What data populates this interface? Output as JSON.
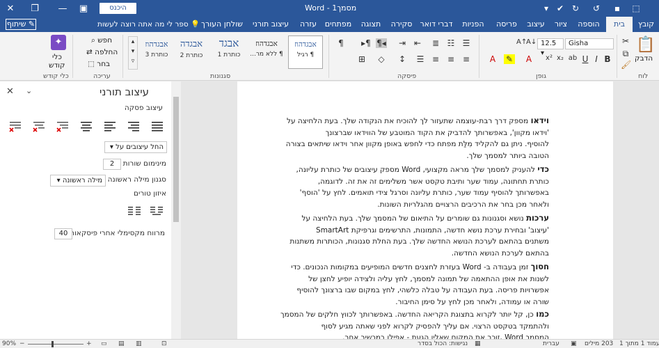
{
  "titlebar": {
    "doc_title": "מסמך1 - Word",
    "signin_label": "היכנס",
    "min_icon": "minimize-icon",
    "max_icon": "restore-icon",
    "close_icon": "close-icon"
  },
  "tabs": [
    "קובץ",
    "בית",
    "הוספה",
    "ציור",
    "עיצוב",
    "פריסה",
    "הפניות",
    "דברי דואר",
    "סקירה",
    "תצוגה",
    "מפתחים",
    "עזרה",
    "עיצוב תורני",
    "שולחן העורך"
  ],
  "tellme": "ספר לי מה אתה רוצה לעשות",
  "share_label": "שיתוף",
  "ribbon": {
    "clipboard": {
      "paste": "הדבק",
      "label": "לוח"
    },
    "font": {
      "name": "Gisha",
      "size": "12.5",
      "label": "גופן"
    },
    "paragraph": {
      "label": "פיסקה"
    },
    "styles": {
      "label": "סגנונות",
      "items": [
        {
          "sample": "אבגדהוז",
          "name": "¶ רגיל"
        },
        {
          "sample": "אבגדהוז",
          "name": "¶ ללא מר..."
        },
        {
          "sample": "אבגד",
          "name": "כותרת 1"
        },
        {
          "sample": "אבגדה",
          "name": "כותרת 2"
        },
        {
          "sample": "אבגדהוז",
          "name": "כותרת 3"
        }
      ]
    },
    "editing": {
      "find": "חפש",
      "replace": "החלפה",
      "select": "בחר",
      "label": "עריכה"
    },
    "holy": {
      "tools": "כלי",
      "holy": "קודש",
      "label": "כלי קודש"
    }
  },
  "pane": {
    "title": "עיצוב תורני",
    "section_paragraph": "עיצוב פסקה",
    "apply_styles": "החל עיצובים על",
    "min_lines_label": "מינימום שורות",
    "min_lines_value": "2",
    "first_word_label": "סגנון מילה ראשונה",
    "first_word_value": "מילה ראשונה",
    "columns_label": "איזון טורים",
    "max_spacing_label": "מרווח מקסימלי אחרי פיסקאות",
    "max_spacing_value": "40"
  },
  "document": {
    "paragraphs": [
      {
        "lead": "וידאו",
        "lines": [
          "מספק דרך רבת-עוצמה שתעזור לך להוכיח את הנקודה שלך. בעת הלחיצה על",
          "'וידאו מקוון', באפשרותך להדביק את הקוד המוטבע של הווידאו שברצונך",
          "להוסיף. ניתן גם להקליד מִלַּת מפתח כדי לחפש באופן מקוון אחר וידאו שיתאים בצורה",
          "הטובה ביותר למסמך שלך."
        ]
      },
      {
        "lead": "כדי",
        "lines": [
          "להעניק למסמך שלך מראה מקצועי, Word מספק עיצובים של כותרת עליונה,",
          "כותרת תחתונה, עמוד שער ותיבת טקסט אשר משלימים זה את זה. לדוגמה,",
          "באפשרותך להוסיף עמוד שער, כותרת עליונה וסרגל צידי תואמים. לחץ על 'הוסף'",
          "ולאחר מכן בחר את הרכיבים הרצויים מהגלריות השונות."
        ]
      },
      {
        "lead": "ערכות",
        "lines": [
          "נושא וסגנונות גם שומרים על התיאום של המסמך שלך. בעת הלחיצה על",
          "'עיצוב' ובחירת ערכת נושא חדשה, התמונות, התרשימים וגרפיקת SmartArt",
          "משתנים בהתאם לערכת הנושא החדשה שלך. בעת החלת סגנונות, הכותרות משתנות",
          "בהתאם לערכת הנושא החדשה."
        ]
      },
      {
        "lead": "חסוך",
        "lines": [
          "זמן בעבודה ב- Word בעזרת לחצנים חדשים המופיעים במקומות הנכונים. כדי",
          "לשנות את אופן ההתאמה של תמונה למסמך, לחץ עליה ולצידה יופיע לחצן של",
          "אפשרויות פריסה. בעת העבודה על טבלה כלשהי, לחץ במקום שבו ברצונך להוסיף",
          "שורה או עמודה, ולאחר מכן לחץ על סימן החיבור."
        ]
      },
      {
        "lead": "כמו",
        "lines": [
          "כן, קל יותר לקרוא בתצוגת הקריאה החדשה. באפשרותך לכווץ חלקים של המסמך",
          "ולהתמקד בטקסט הרצוי. אם עליך להפסיק לקרוא לפני שאתה מגיע לסוף",
          "המסמך Word ,זוכר את המקום שאליו הגעת - אפילו במכשיר אחר."
        ]
      }
    ]
  },
  "status": {
    "page": "עמוד 1 מתוך 1",
    "words": "203 מילים",
    "language": "עברית",
    "accessibility": "נגישות: הכול בסדר",
    "zoom": "90%"
  },
  "colors": {
    "brand": "#2b579a",
    "ribbon_bg": "#f3f3f3",
    "doc_bg": "#e6e6e6"
  }
}
